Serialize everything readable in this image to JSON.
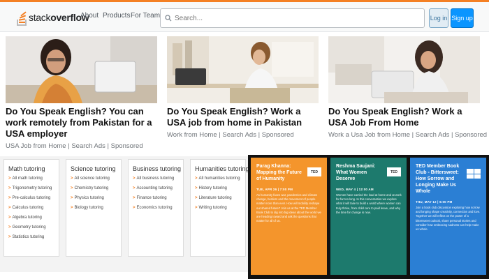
{
  "header": {
    "logo_light": "stack",
    "logo_bold": "overflow",
    "nav": [
      "About",
      "Products",
      "For Teams"
    ],
    "search_placeholder": "Search...",
    "login_label": "Log in",
    "signup_label": "Sign up"
  },
  "ads": [
    {
      "title": "Do You Speak English? You can work remotely from Pakistan for a USA employer",
      "meta": "USA Job from Home | Search Ads | Sponsored"
    },
    {
      "title": "Do You Speak English? Work a USA job from home in Pakistan",
      "meta": "Work from Home | Search Ads | Sponsored"
    },
    {
      "title": "Do You Speak English? Work a USA Job From Home",
      "meta": "Work a Usa Job from Home | Search Ads | Sponsored"
    }
  ],
  "tutoring": [
    {
      "heading": "Math tutoring",
      "items": [
        "All math tutoring",
        "Trigonometry tutoring",
        "Pre-calculus tutoring",
        "Calculus tutoring",
        "Algebra tutoring",
        "Geometry tutoring",
        "Statistics tutoring"
      ]
    },
    {
      "heading": "Science tutoring",
      "items": [
        "All science tutoring",
        "Chemistry tutoring",
        "Physics tutoring",
        "Biology tutoring"
      ]
    },
    {
      "heading": "Business tutoring",
      "items": [
        "All business tutoring",
        "Accounting tutoring",
        "Finance tutoring",
        "Economics tutoring"
      ]
    },
    {
      "heading": "Humanities tutoring",
      "items": [
        "All humanities tutoring",
        "History tutoring",
        "Literature tutoring",
        "Writing tutoring"
      ]
    }
  ],
  "talks": [
    {
      "title": "Parag Khanna: Mapping the Future of Humanity",
      "date": "TUE, APR 26 | 7:00 PM",
      "body": "As humanity faces war, pandemics and climate change, borders and the movement of people matter more than ever. How will mobility reshape our shared future? Join us at the TED Member Book Club to dig into big ideas about the world we are heading toward and ask the questions that matter for all of us.",
      "color": "#f4952c",
      "icon": "TED"
    },
    {
      "title": "Reshma Saujani: What Women Deserve",
      "date": "WED, MAY 4 | 12:00 AM",
      "body": "Women have carried the load at home and at work for far too long. In this conversation we explore what it will take to build a world where women can truly thrive, from child care to paid leave, and why the time for change is now.",
      "color": "#1d7a6d",
      "icon": "TED"
    },
    {
      "title": "TED Member Book Club - Bittersweet: How Sorrow and Longing Make Us Whole",
      "date": "THU, MAY 12 | 6:00 PM",
      "body": "Join a book club discussion exploring how sorrow and longing shape creativity, connection and love. Together we will reflect on the power of a bittersweet outlook, share personal stories and consider how embracing sadness can help make us whole.",
      "color": "#2b7fd4",
      "icon": "grid"
    }
  ]
}
